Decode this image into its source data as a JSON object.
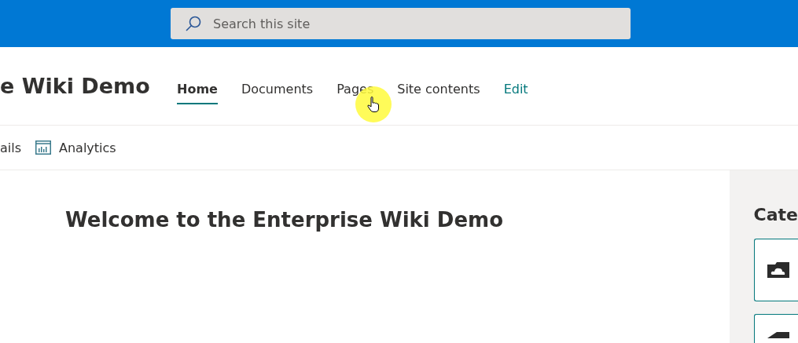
{
  "search": {
    "placeholder": "Search this site"
  },
  "site_title": "e Wiki Demo",
  "nav": [
    {
      "label": "Home",
      "selected": true,
      "kind": "link"
    },
    {
      "label": "Documents",
      "selected": false,
      "kind": "link"
    },
    {
      "label": "Pages",
      "selected": false,
      "kind": "link"
    },
    {
      "label": "Site contents",
      "selected": false,
      "kind": "link"
    },
    {
      "label": "Edit",
      "selected": false,
      "kind": "edit"
    }
  ],
  "toolbar": [
    {
      "label": "ails",
      "kind": "text"
    },
    {
      "label": "Analytics",
      "kind": "analytics"
    }
  ],
  "heading": "Welcome to the Enterprise Wiki Demo",
  "side_panel": {
    "title": "Cate",
    "cards": [
      {
        "kind": "cloud"
      },
      {
        "kind": "other"
      }
    ]
  }
}
